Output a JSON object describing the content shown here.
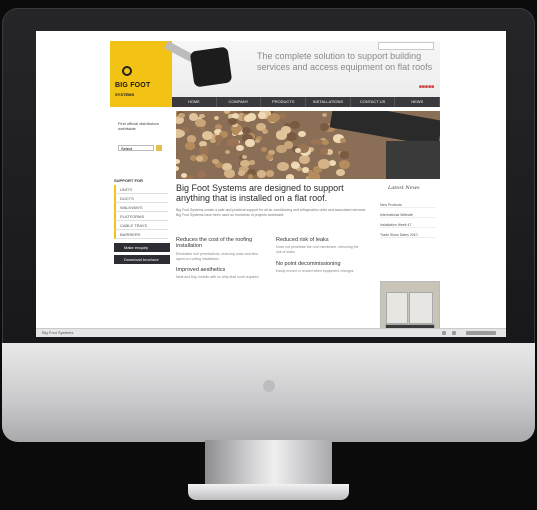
{
  "brand": {
    "name": "BIG FOOT",
    "sub": "SYSTEMS"
  },
  "header": {
    "tagline": "The complete solution to support building services and access equipment on flat roofs"
  },
  "nav": [
    "HOME",
    "COMPANY",
    "PRODUCTS",
    "INSTALLATIONS",
    "CONTACT US",
    "NEWS"
  ],
  "left": {
    "office_label": "Find official distributors worldwide",
    "select_value": "Select",
    "support_head": "SUPPORT FOR",
    "items": [
      "UNITS",
      "DUCTS",
      "WALKWAYS",
      "PLATFORMS",
      "CABLE TRAYS",
      "BARRIERS"
    ],
    "buttons": [
      "Make enquiry",
      "Download brochure"
    ]
  },
  "main": {
    "title": "Big Foot Systems are designed to support anything that is installed on a flat roof.",
    "intro": "Big Foot Systems create a safe and practical support for all air conditioning and refrigeration units and associated services. Big Foot Systems have been used on hundreds of projects worldwide.",
    "blocks": [
      {
        "title": "Reduces the cost of the roofing installation",
        "text": "Eliminates roof penetrations, reducing costs and time spent on roofing installation."
      },
      {
        "title": "Reduced risk of leaks",
        "text": "Does not penetrate the roof membrane, removing the risk of leaks."
      },
      {
        "title": "Improved aesthetics",
        "text": "Neat and tidy, installs with no dirty lead work required."
      },
      {
        "title": "No point decommissioning",
        "text": "Easily moved or reused when equipment changes."
      }
    ]
  },
  "right": {
    "head": "Latest News",
    "items": [
      "New Products",
      "International Website",
      "Installation Week 47",
      "Trade Show Dates 2010"
    ]
  },
  "statusbar": {
    "title": "Big Foot Systems"
  }
}
